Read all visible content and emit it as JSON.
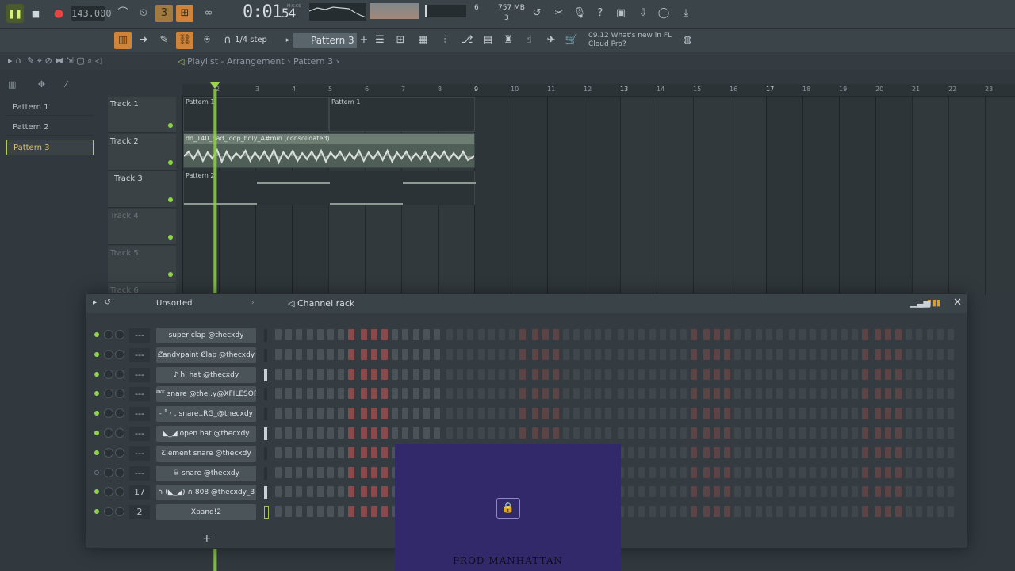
{
  "toolbar": {
    "tempo": "143.000",
    "time": "0:01",
    "time_secs": "54",
    "time_label": "M:S:CS",
    "cpu": "6",
    "memory": "757 MB",
    "polyphony": "3",
    "step": "1/4 step",
    "pattern": "Pattern 3",
    "news_line1": "09.12  What's new in FL",
    "news_line2": "Cloud Pro?"
  },
  "playlist": {
    "title": "Playlist - Arrangement",
    "sep": "›",
    "current": "Pattern 3",
    "ruler": [
      "2",
      "3",
      "4",
      "5",
      "6",
      "7",
      "8",
      "9",
      "10",
      "11",
      "12",
      "13",
      "14",
      "15",
      "16",
      "17",
      "18",
      "19",
      "20",
      "21",
      "22",
      "23"
    ]
  },
  "patterns": [
    "Pattern 1",
    "Pattern 2",
    "Pattern 3"
  ],
  "tracks": [
    "Track 1",
    "Track 2",
    "Track 3",
    "Track 4",
    "Track 5",
    "Track 6"
  ],
  "clips": {
    "p1a": "Pattern 1",
    "p1b": "Pattern 1",
    "audio": "dd_140_pad_loop_holy_A#min (consolidated)",
    "p2": "Pattern 2"
  },
  "rack": {
    "filter": "Unsorted",
    "title": "Channel rack",
    "channels": [
      {
        "name": "ꜱuper clap @thecxdy",
        "mix": "---",
        "led": true
      },
      {
        "name": "Ȼandypaint Ȼlap @thecxdy",
        "mix": "---",
        "led": true
      },
      {
        "name": "♪ hi hat @thecxdy",
        "mix": "---",
        "led": true
      },
      {
        "name": "ᴾᴷᴷ snare @the..y@XFILESORG_",
        "mix": "---",
        "led": true
      },
      {
        "name": "˗ ˚ · .  snare..RG_@thecxdy",
        "mix": "---",
        "led": true
      },
      {
        "name": "◣_◢ open hat @thecxdy",
        "mix": "---",
        "led": true
      },
      {
        "name": "Ƹlement snare @thecxdy",
        "mix": "---",
        "led": true
      },
      {
        "name": "☠ snare @thecxdy",
        "mix": "---",
        "led": false
      },
      {
        "name": "∩ (◣_◢) ∩ 808 @thecxdy_3",
        "mix": "17",
        "led": true
      },
      {
        "name": "Xpand!2",
        "mix": "2",
        "led": true
      }
    ]
  },
  "overlay": {
    "label": "PROD MANHATTAN"
  },
  "colors": {
    "accent_green": "#8fd34a",
    "step_on": "#8a4a4c",
    "orange": "#d0843a"
  }
}
